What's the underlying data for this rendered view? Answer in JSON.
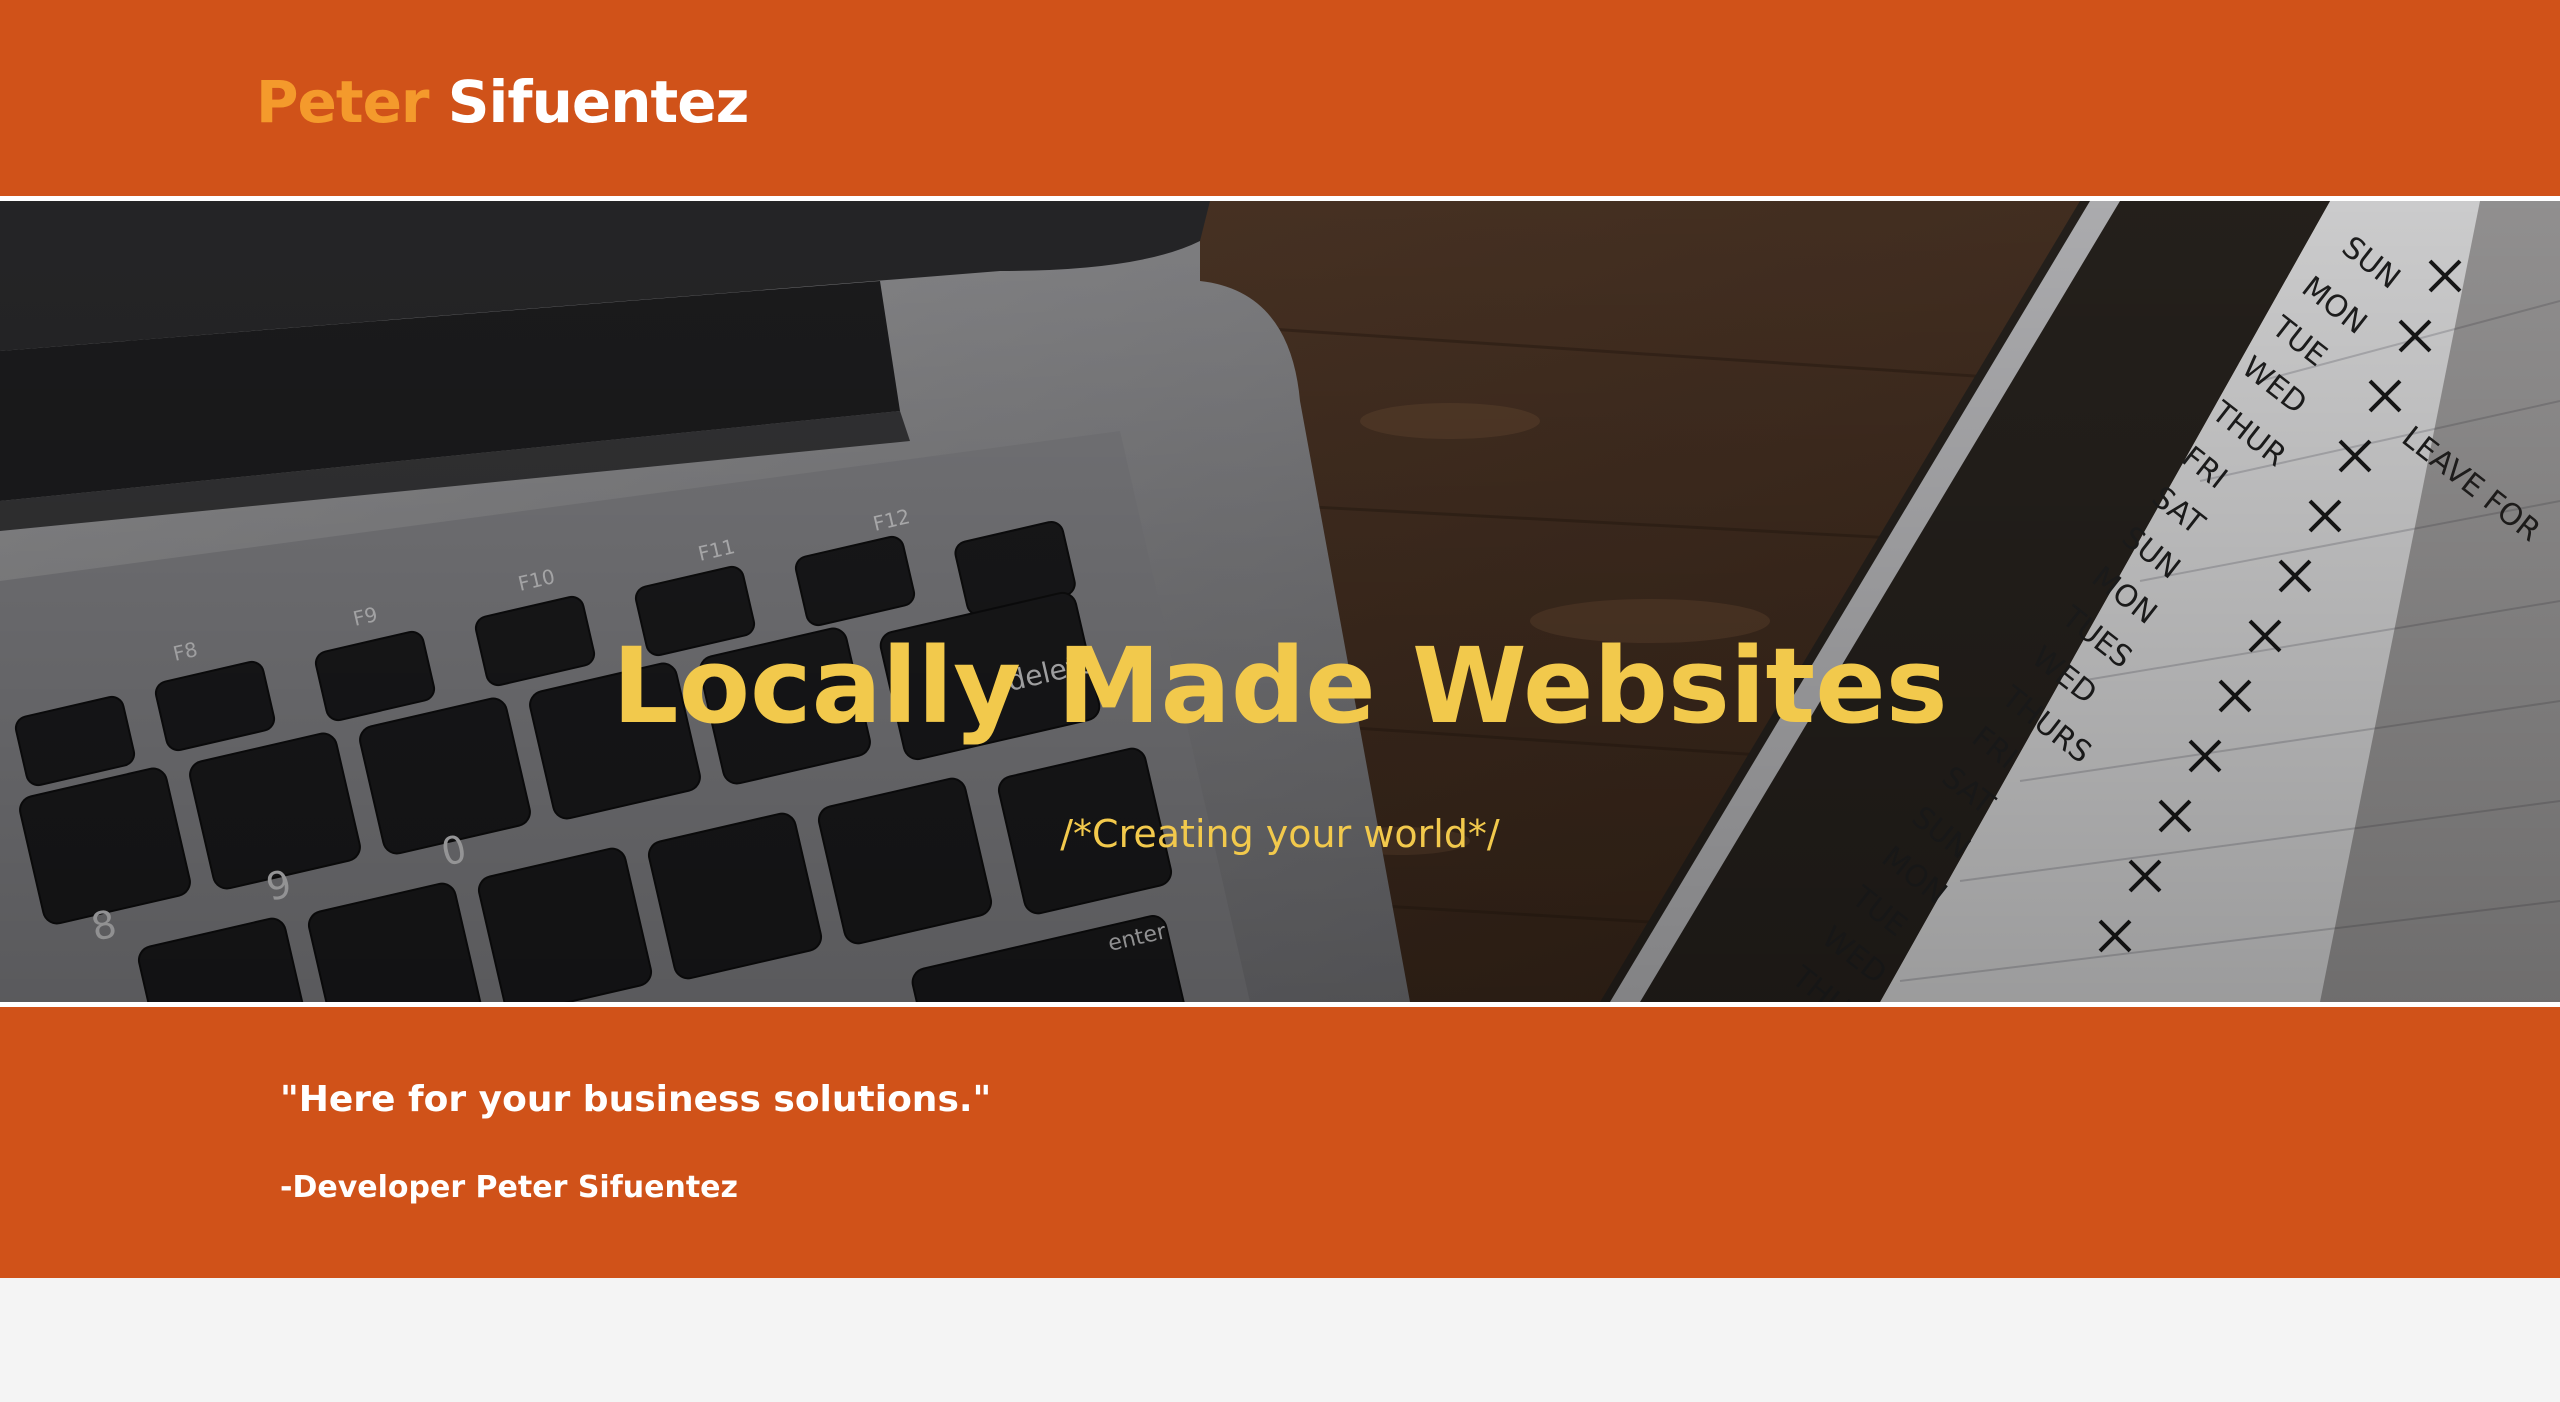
{
  "header": {
    "brand_first": "Peter",
    "brand_last": "Sifuentez"
  },
  "hero": {
    "title": "Locally Made Websites",
    "subtitle": "/*Creating your world*/",
    "background_image": "laptop-keyboard-and-notebook-photo"
  },
  "quote": {
    "text": "\"Here for your business solutions.\"",
    "author": "-Developer Peter Sifuentez"
  },
  "colors": {
    "brand_orange": "#d05219",
    "brand_first_name": "#f49a2c",
    "hero_text": "#f2c94c",
    "page_background": "#f4f4f4"
  }
}
